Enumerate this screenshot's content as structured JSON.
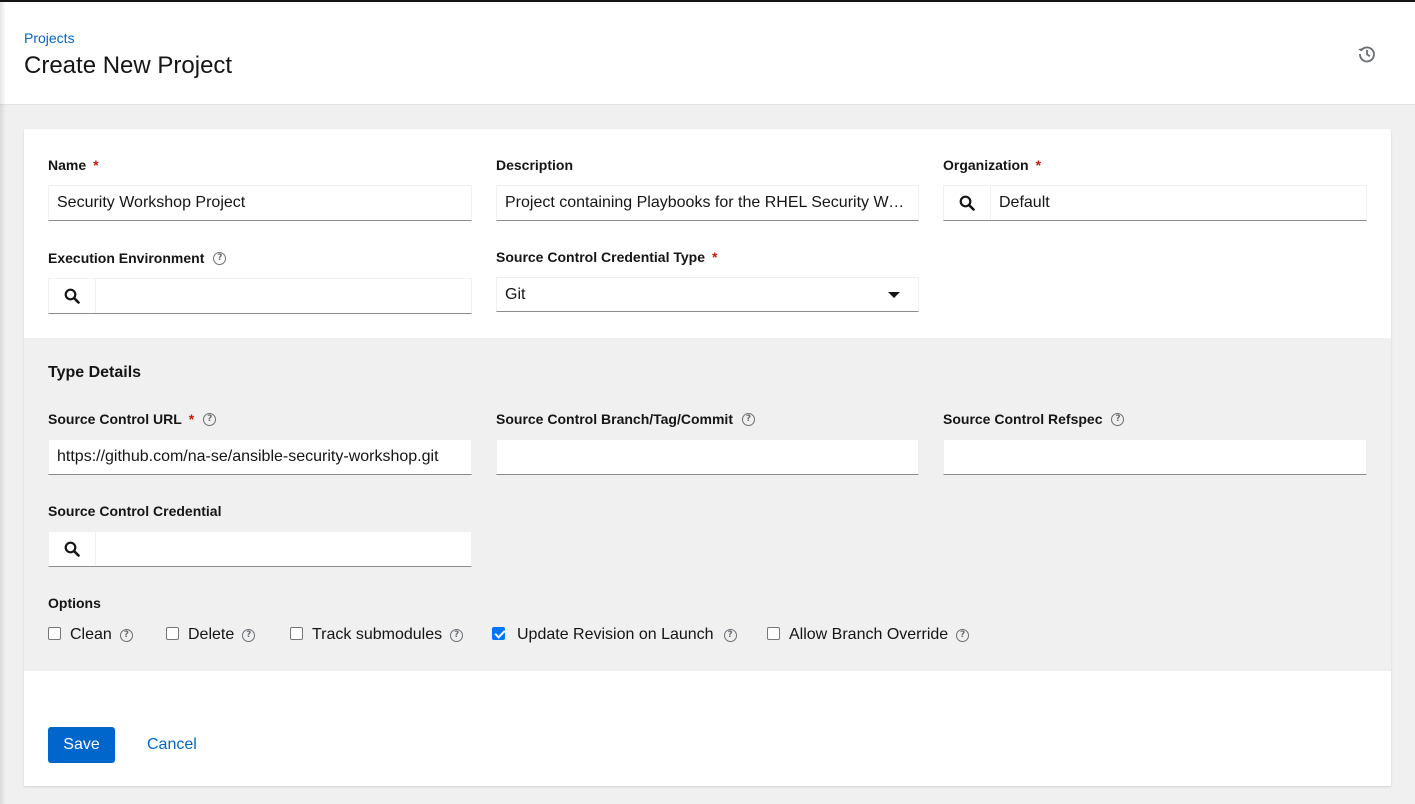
{
  "header": {
    "breadcrumb": "Projects",
    "title": "Create New Project",
    "history_icon": "history-icon"
  },
  "form": {
    "name": {
      "label": "Name",
      "required": "*",
      "value": "Security Workshop Project"
    },
    "description": {
      "label": "Description",
      "value": "Project containing Playbooks for the RHEL Security Workshop"
    },
    "organization": {
      "label": "Organization",
      "required": "*",
      "value": "Default"
    },
    "execution_environment": {
      "label": "Execution Environment",
      "help": "?",
      "value": ""
    },
    "scm_type": {
      "label": "Source Control Credential Type",
      "required": "*",
      "value": "Git"
    }
  },
  "type_details": {
    "title": "Type Details",
    "scm_url": {
      "label": "Source Control URL",
      "required": "*",
      "help": "?",
      "value": "https://github.com/na-se/ansible-security-workshop.git"
    },
    "scm_branch": {
      "label": "Source Control Branch/Tag/Commit",
      "help": "?",
      "value": ""
    },
    "scm_refspec": {
      "label": "Source Control Refspec",
      "help": "?",
      "value": ""
    },
    "scm_credential": {
      "label": "Source Control Credential",
      "value": ""
    }
  },
  "options": {
    "label": "Options",
    "items": [
      {
        "label": "Clean",
        "checked": false,
        "help": "?"
      },
      {
        "label": "Delete",
        "checked": false,
        "help": "?"
      },
      {
        "label": "Track submodules",
        "checked": false,
        "help": "?"
      },
      {
        "label": "Update Revision on Launch",
        "checked": true,
        "help": "?"
      },
      {
        "label": "Allow Branch Override",
        "checked": false,
        "help": "?"
      }
    ]
  },
  "actions": {
    "save_label": "Save",
    "cancel_label": "Cancel"
  },
  "colors": {
    "accent": "#0066cc",
    "required": "#c9190b",
    "checkbox_checked": "#0075ff"
  }
}
